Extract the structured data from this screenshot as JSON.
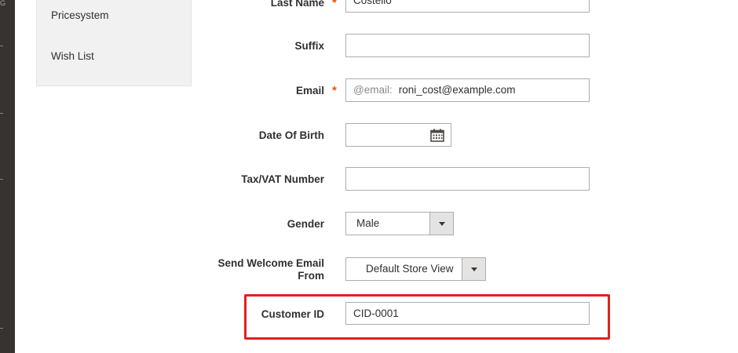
{
  "sidebar": {
    "items": [
      {
        "label": "Pricesystem"
      },
      {
        "label": "Wish List"
      }
    ]
  },
  "form": {
    "last_name": {
      "label": "Last Name",
      "value": "Costello",
      "required_mark": "*"
    },
    "suffix": {
      "label": "Suffix",
      "value": ""
    },
    "email": {
      "label": "Email",
      "required_mark": "*",
      "addon": "@email:",
      "value": "roni_cost@example.com"
    },
    "dob": {
      "label": "Date Of Birth",
      "value": ""
    },
    "tax_vat": {
      "label": "Tax/VAT Number",
      "value": ""
    },
    "gender": {
      "label": "Gender",
      "value": "Male"
    },
    "welcome_email": {
      "label_line1": "Send Welcome Email",
      "label_line2": "From",
      "value": "Default Store View"
    },
    "customer_id": {
      "label": "Customer ID",
      "value": "CID-0001"
    }
  },
  "colors": {
    "highlight": "#e02020",
    "required": "#eb5202",
    "admin_strip": "#373330"
  }
}
